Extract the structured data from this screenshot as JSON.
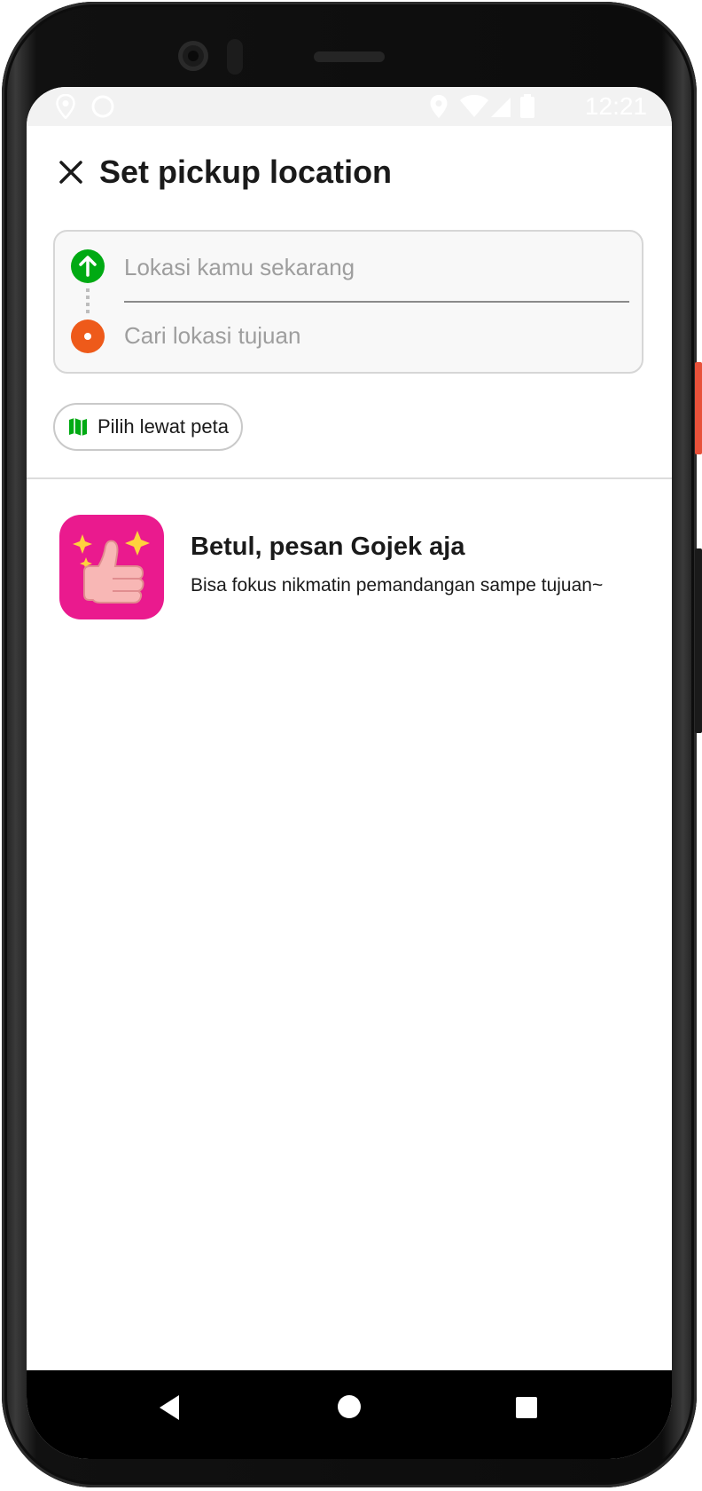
{
  "status_bar": {
    "time": "12:21",
    "icons": [
      "map-pin-icon",
      "circle-notification-icon",
      "location-icon",
      "wifi-icon",
      "signal-icon",
      "battery-icon"
    ]
  },
  "header": {
    "title": "Set pickup location",
    "close_icon": "close-icon"
  },
  "route": {
    "pickup_placeholder": "Lokasi kamu sekarang",
    "pickup_value": "",
    "destination_placeholder": "Cari lokasi tujuan",
    "destination_value": "",
    "pickup_color": "#00aa13",
    "destination_color": "#ee5a1a"
  },
  "map_chip": {
    "label": "Pilih lewat peta",
    "icon": "map-icon",
    "icon_color": "#00aa13"
  },
  "promo": {
    "title": "Betul, pesan Gojek aja",
    "description": "Bisa fokus nikmatin pemandangan sampe tujuan~",
    "icon": "thumbs-up-sparkle-icon",
    "icon_bg": "#ea1a8e"
  },
  "nav_bar": {
    "buttons": [
      "back-icon",
      "home-icon",
      "recents-icon"
    ]
  }
}
